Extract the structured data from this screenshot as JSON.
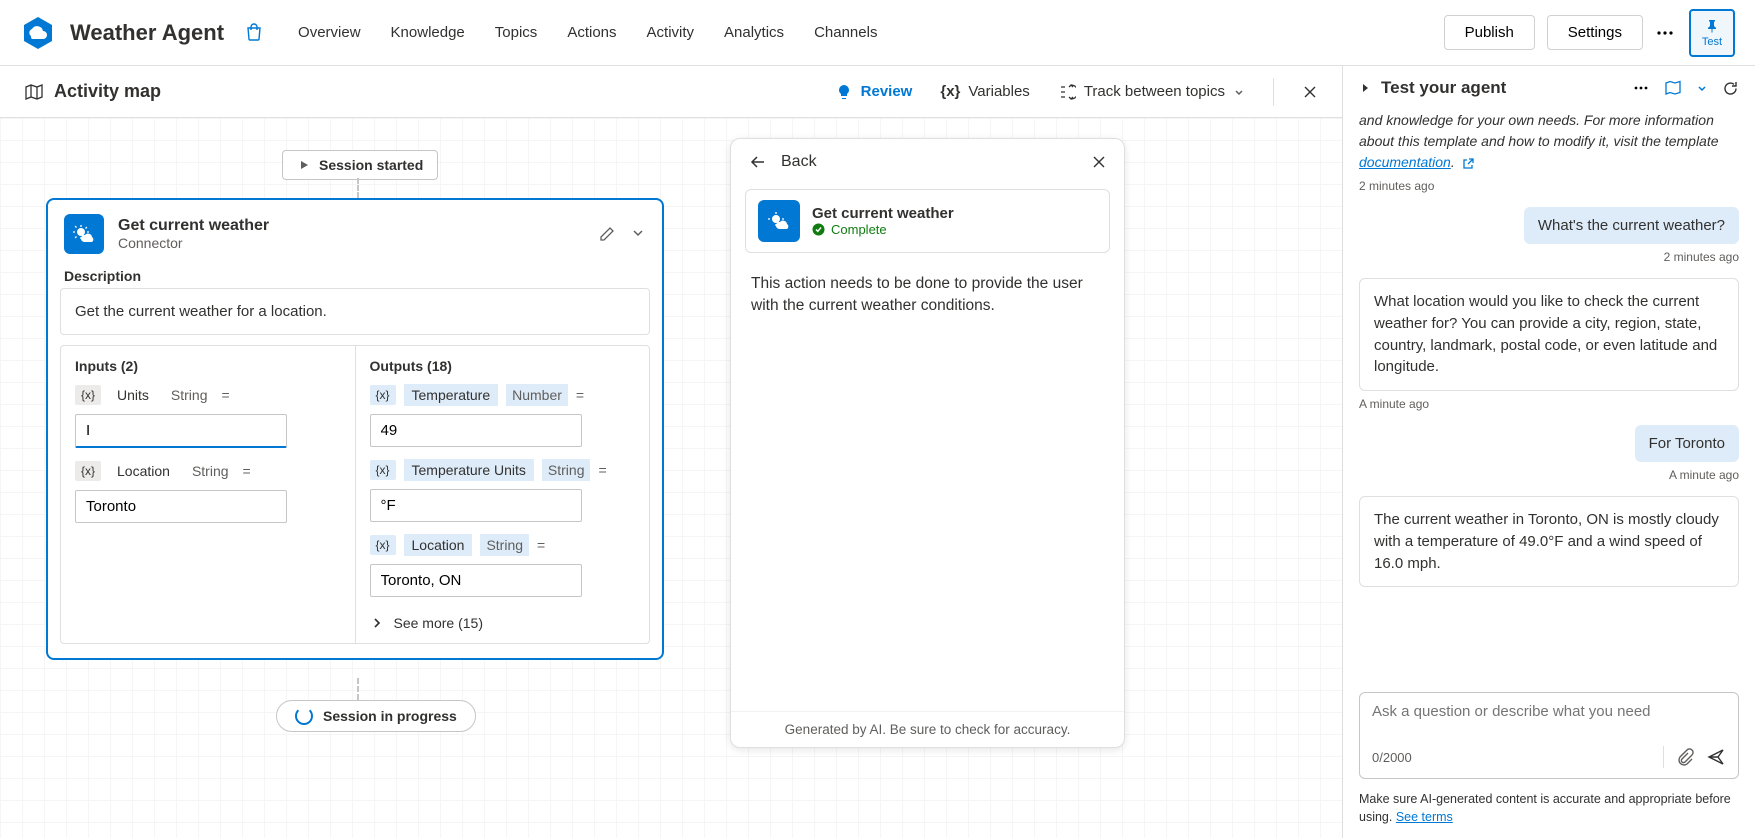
{
  "header": {
    "agent_name": "Weather Agent",
    "nav": [
      "Overview",
      "Knowledge",
      "Topics",
      "Actions",
      "Activity",
      "Analytics",
      "Channels"
    ],
    "publish": "Publish",
    "settings": "Settings",
    "test": "Test"
  },
  "toolbar": {
    "title": "Activity map",
    "review": "Review",
    "variables": "Variables",
    "track": "Track between topics"
  },
  "session_started": "Session started",
  "session_progress": "Session in progress",
  "weather_card": {
    "title": "Get current weather",
    "subtitle": "Connector",
    "desc_label": "Description",
    "description": "Get the current weather for a location.",
    "inputs_label": "Inputs (2)",
    "outputs_label": "Outputs (18)",
    "inputs": [
      {
        "name": "Units",
        "type": "String",
        "value": "I"
      },
      {
        "name": "Location",
        "type": "String",
        "value": "Toronto"
      }
    ],
    "outputs": [
      {
        "name": "Temperature",
        "type": "Number",
        "value": "49"
      },
      {
        "name": "Temperature Units",
        "type": "String",
        "value": "°F"
      },
      {
        "name": "Location",
        "type": "String",
        "value": "Toronto, ON"
      }
    ],
    "see_more": "See more (15)"
  },
  "detail": {
    "back": "Back",
    "title": "Get current weather",
    "status": "Complete",
    "body": "This action needs to be done to provide the user with the current weather conditions.",
    "foot": "Generated by AI. Be sure to check for accuracy."
  },
  "test_panel": {
    "title": "Test your agent",
    "intro_pre": "and knowledge for your own needs. For more information about this template and how to modify it, visit the template ",
    "intro_link": "documentation",
    "ts1": "2 minutes ago",
    "user1": "What's the current weather?",
    "ts2": "2 minutes ago",
    "bot1": "What location would you like to check the current weather for? You can provide a city, region, state, country, landmark, postal code, or even latitude and longitude.",
    "ts3": "A minute ago",
    "user2": "For Toronto",
    "ts4": "A minute ago",
    "bot2": "The current weather in Toronto, ON is mostly cloudy with a temperature of 49.0°F and a wind speed of 16.0 mph.",
    "placeholder": "Ask a question or describe what you need",
    "count": "0/2000",
    "disclaimer_pre": "Make sure AI-generated content is accurate and appropriate before using. ",
    "disclaimer_link": "See terms"
  }
}
